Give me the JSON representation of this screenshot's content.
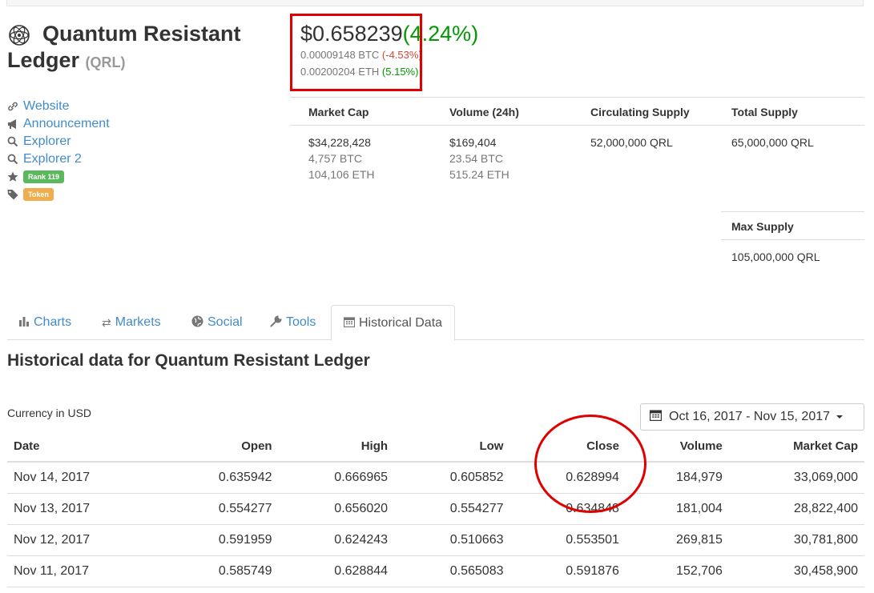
{
  "coin": {
    "name": "Quantum Resistant Ledger",
    "name_line1": "Quantum Resistant",
    "name_line2": "Ledger",
    "symbol": "(QRL)"
  },
  "links": [
    {
      "icon": "link-icon",
      "label": "Website"
    },
    {
      "icon": "megaphone-icon",
      "label": "Announcement"
    },
    {
      "icon": "search-icon",
      "label": "Explorer"
    },
    {
      "icon": "search-icon",
      "label": "Explorer 2"
    }
  ],
  "badges": {
    "rank": "Rank 119",
    "tag": "Token"
  },
  "price": {
    "usd": "$0.658239",
    "usd_change": "(4.24%)",
    "btc": "0.00009148 BTC",
    "btc_change": "(-4.53%)",
    "eth": "0.00200204 ETH",
    "eth_change": "(5.15%)"
  },
  "stats": {
    "market_cap_label": "Market Cap",
    "market_cap_usd": "$34,228,428",
    "market_cap_btc": "4,757 BTC",
    "market_cap_eth": "104,106 ETH",
    "volume_label": "Volume (24h)",
    "volume_usd": "$169,404",
    "volume_btc": "23.54 BTC",
    "volume_eth": "515.24 ETH",
    "circulating_label": "Circulating Supply",
    "circulating_value": "52,000,000 QRL",
    "total_label": "Total Supply",
    "total_value": "65,000,000 QRL",
    "max_label": "Max Supply",
    "max_value": "105,000,000 QRL"
  },
  "tabs": [
    {
      "label": "Charts",
      "icon": "bar-chart-icon"
    },
    {
      "label": "Markets",
      "icon": "exchange-icon"
    },
    {
      "label": "Social",
      "icon": "globe-icon"
    },
    {
      "label": "Tools",
      "icon": "wrench-icon"
    },
    {
      "label": "Historical Data",
      "icon": "calendar-icon",
      "active": true
    }
  ],
  "historical": {
    "title": "Historical data for Quantum Resistant Ledger",
    "currency": "Currency in USD",
    "date_range": "Oct 16, 2017 - Nov 15, 2017",
    "columns": [
      "Date",
      "Open",
      "High",
      "Low",
      "Close",
      "Volume",
      "Market Cap"
    ],
    "rows": [
      [
        "Nov 14, 2017",
        "0.635942",
        "0.666965",
        "0.605852",
        "0.628994",
        "184,979",
        "33,069,000"
      ],
      [
        "Nov 13, 2017",
        "0.554277",
        "0.656020",
        "0.554277",
        "0.634848",
        "181,004",
        "28,822,400"
      ],
      [
        "Nov 12, 2017",
        "0.591959",
        "0.624243",
        "0.510663",
        "0.553501",
        "269,815",
        "30,781,800"
      ],
      [
        "Nov 11, 2017",
        "0.585749",
        "0.628844",
        "0.565083",
        "0.591876",
        "152,706",
        "30,458,900"
      ]
    ]
  },
  "colors": {
    "link": "#428bca",
    "positive": "#009900",
    "negative": "#d14836",
    "annotation": "#e00000",
    "badge_green": "#5cb85c",
    "badge_orange": "#f0ad4e"
  }
}
